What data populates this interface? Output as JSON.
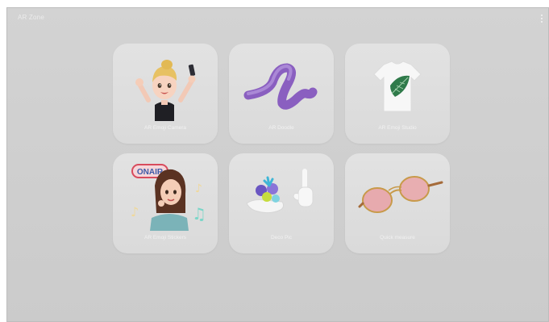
{
  "app": {
    "title": "AR Zone",
    "menu_icon": "more-vertical-icon"
  },
  "tiles": [
    {
      "label": "AR Emoji Camera",
      "icon": "emoji-selfie-icon"
    },
    {
      "label": "AR Doodle",
      "icon": "doodle-squiggle-icon"
    },
    {
      "label": "AR Emoji Studio",
      "icon": "tshirt-leaf-icon"
    },
    {
      "label": "AR Emoji Stickers",
      "icon": "emoji-stickers-icon",
      "badge_text": "ONAIR"
    },
    {
      "label": "Deco Pic",
      "icon": "deco-pic-icon"
    },
    {
      "label": "Quick measure",
      "icon": "sunglasses-icon"
    }
  ],
  "colors": {
    "background": "#d1d1d1",
    "tile": "#dedede",
    "label_text": "#f2f2f2"
  }
}
